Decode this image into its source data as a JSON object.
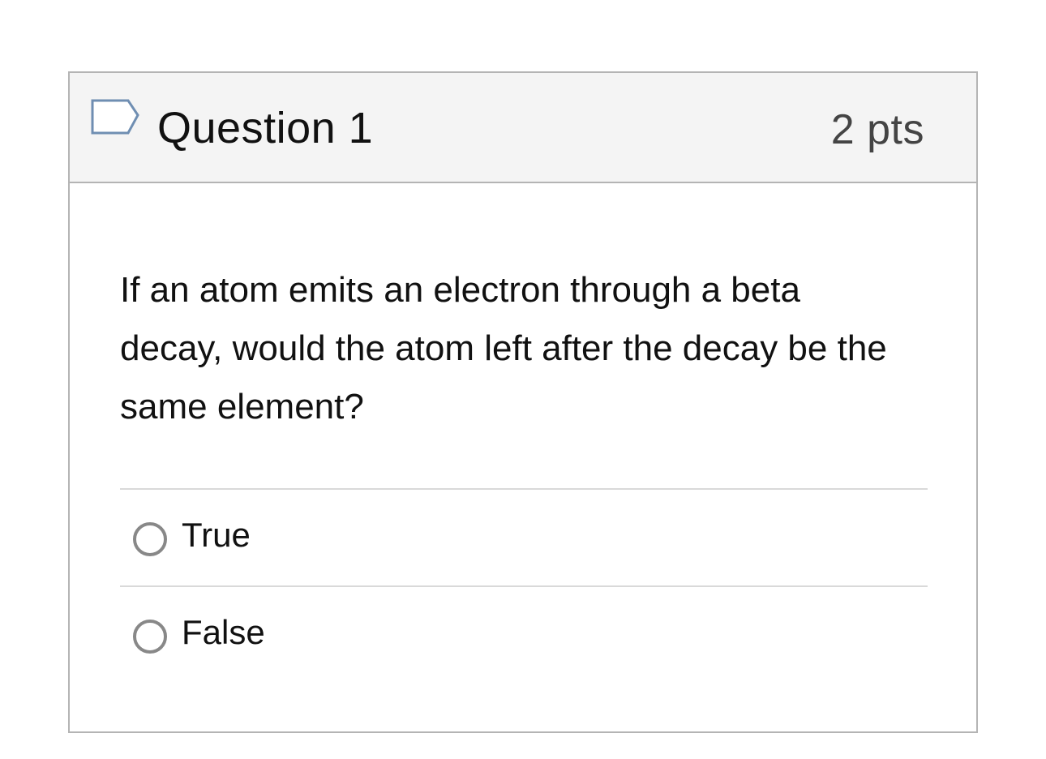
{
  "question": {
    "title": "Question 1",
    "points": "2 pts",
    "text": "If an atom emits an electron through a beta decay, would the atom left after the decay be the same element?",
    "flag_icon": "flag-outline-icon",
    "accent_color": "#6f8eb2"
  },
  "answers": [
    {
      "label": "True",
      "selected": false
    },
    {
      "label": "False",
      "selected": false
    }
  ]
}
